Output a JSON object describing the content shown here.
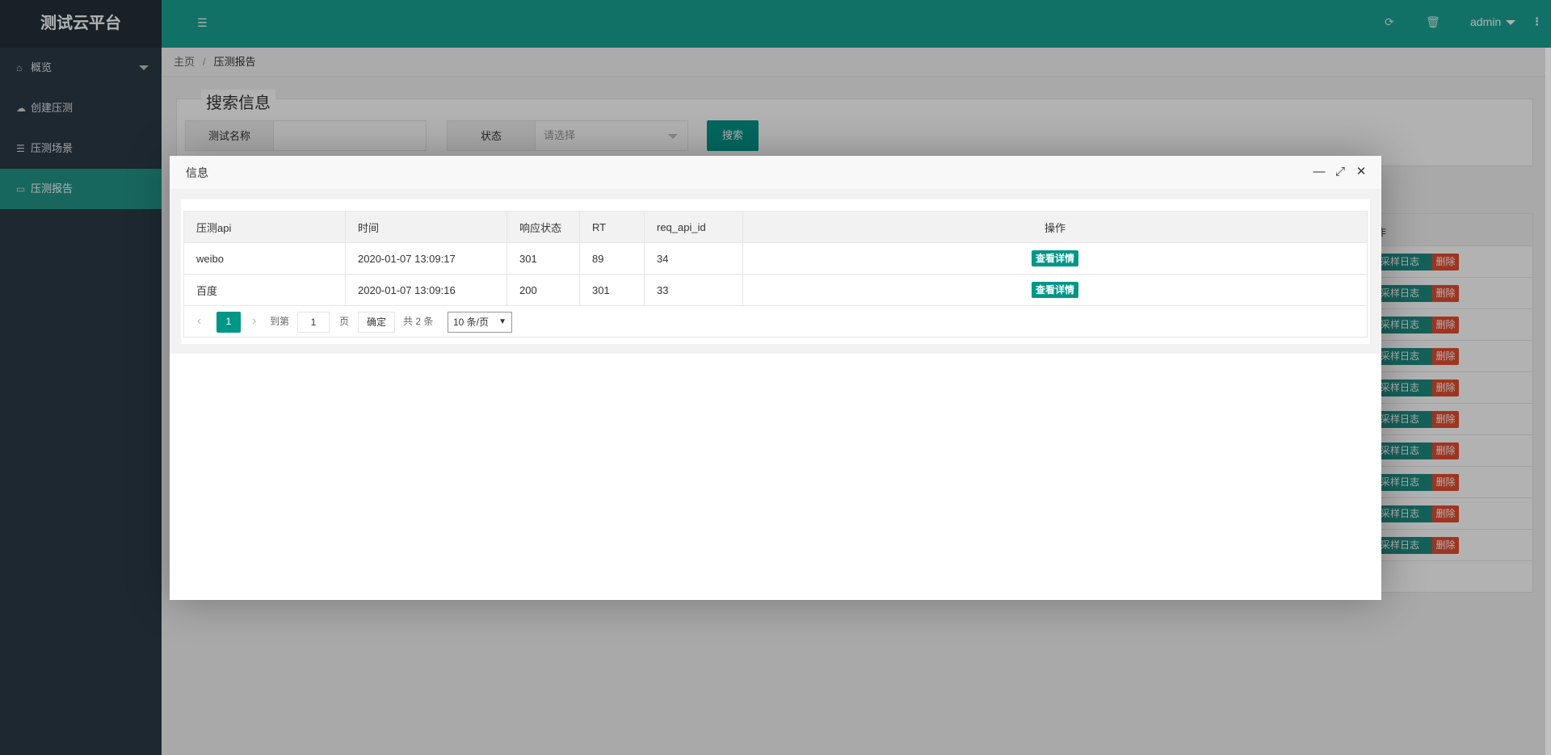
{
  "app": {
    "title": "测试云平台"
  },
  "sidebar": {
    "items": [
      {
        "label": "概览",
        "icon": "home-icon"
      },
      {
        "label": "创建压测",
        "icon": "cloud-icon"
      },
      {
        "label": "压测场景",
        "icon": "server-icon"
      },
      {
        "label": "压测报告",
        "icon": "monitor-icon"
      }
    ]
  },
  "header": {
    "user": "admin"
  },
  "breadcrumb": {
    "home": "主页",
    "sep": "/",
    "current": "压测报告"
  },
  "search": {
    "legend": "搜索信息",
    "name_label": "测试名称",
    "status_label": "状态",
    "status_placeholder": "请选择",
    "search_button": "搜索"
  },
  "bg_table": {
    "header_partial": "作",
    "log_button": "采样日志",
    "delete_button": "删除",
    "row_count": 10
  },
  "modal": {
    "title": "信息",
    "table": {
      "columns": [
        "压测api",
        "时间",
        "响应状态",
        "RT",
        "req_api_id",
        "操作"
      ],
      "rows": [
        [
          "weibo",
          "2020-01-07 13:09:17",
          "301",
          "89",
          "34"
        ],
        [
          "百度",
          "2020-01-07 13:09:16",
          "200",
          "301",
          "33"
        ]
      ],
      "detail_button": "查看详情"
    },
    "pagination": {
      "current_page": "1",
      "goto_label": "到第",
      "goto_value": "1",
      "page_suffix": "页",
      "confirm": "确定",
      "total": "共 2 条",
      "per_page": "10 条/页"
    }
  },
  "colors": {
    "sidebar": "#2a3a46",
    "header": "#1aa394",
    "accent": "#009688",
    "danger": "#e24c30"
  }
}
